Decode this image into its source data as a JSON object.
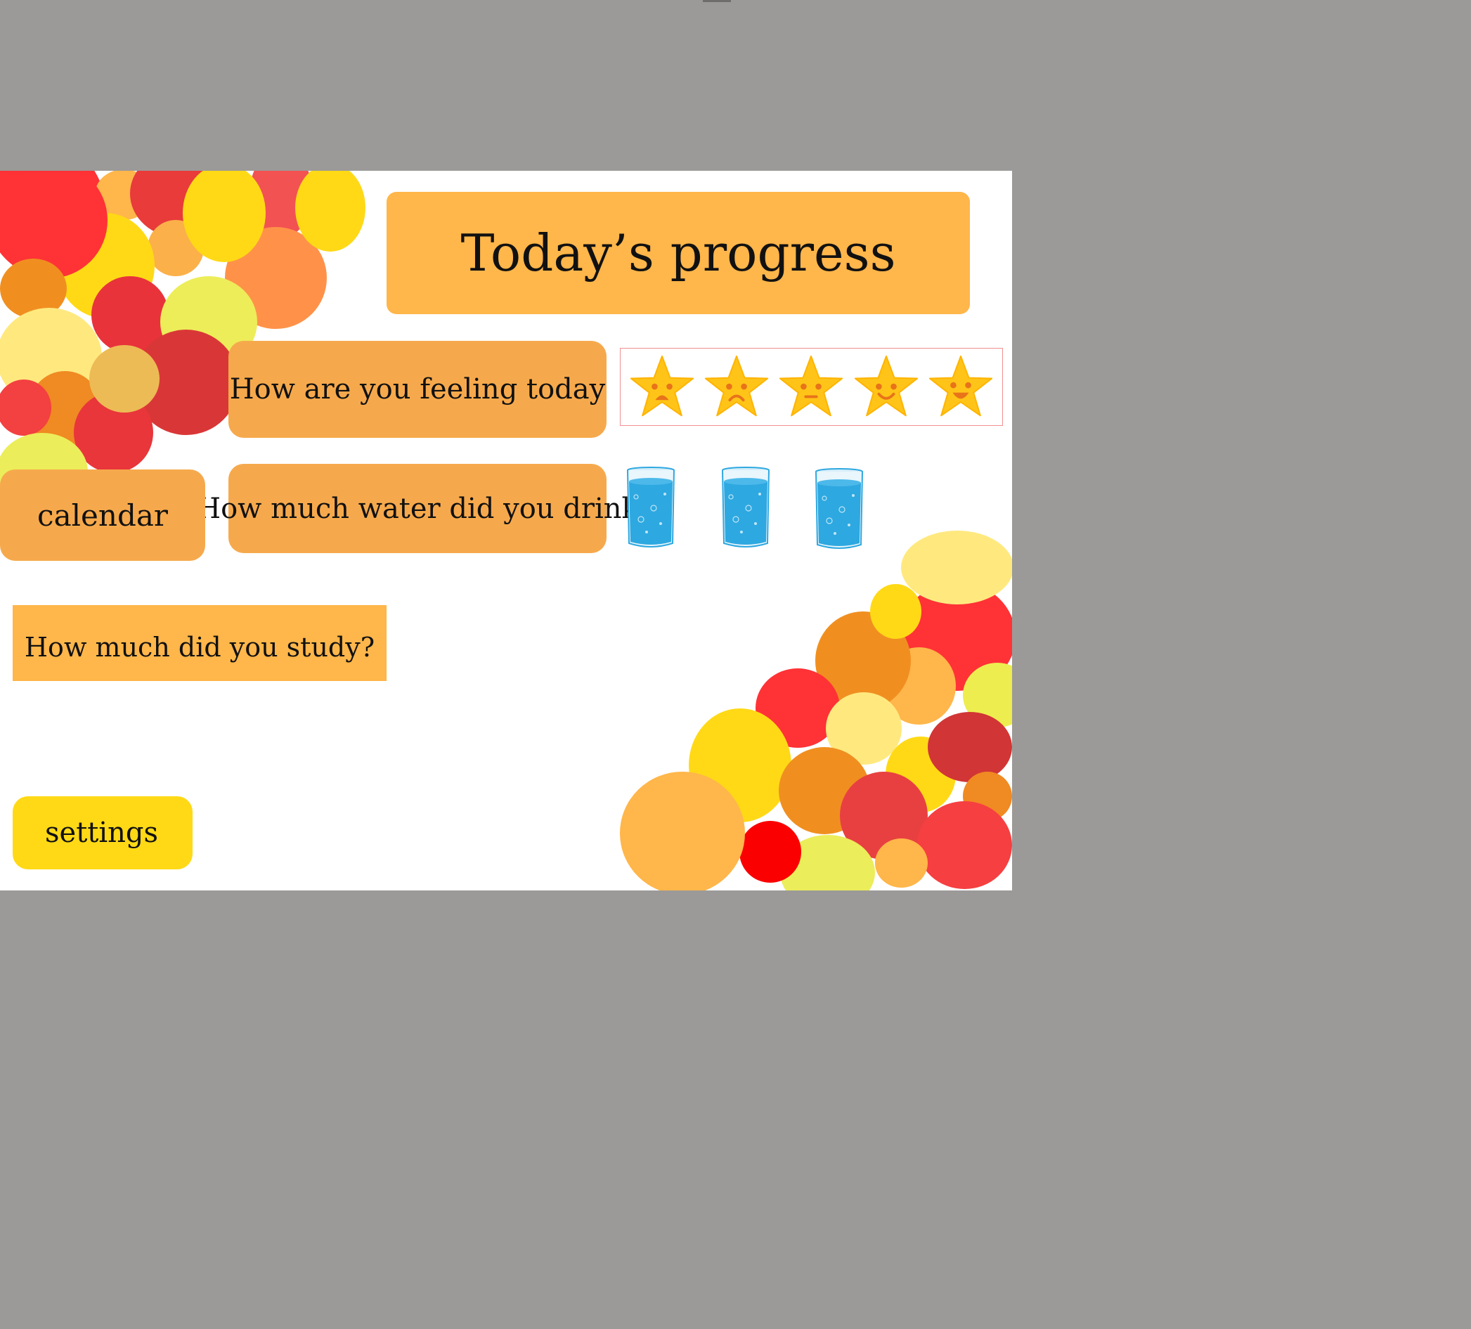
{
  "page": {
    "title": "Today’s progress"
  },
  "questions": {
    "feeling": "How are you feeling today",
    "water": "How much water did you drink",
    "study": "How much did you study?"
  },
  "nav": {
    "calendar_label": "calendar",
    "settings_label": "settings"
  },
  "mood_rating": {
    "options": [
      "very-sad-star-icon",
      "sad-star-icon",
      "neutral-star-icon",
      "smile-star-icon",
      "happy-star-icon"
    ]
  },
  "water_glasses": {
    "count": 3,
    "icon": "water-glass-icon"
  },
  "colors": {
    "background": "#9b9a98",
    "slide": "#ffffff",
    "title_panel": "#ffb64a",
    "question_panel": "#f6a94c",
    "settings_button": "#ffd916",
    "star": "#ffc417",
    "star_face": "#e8731a",
    "water": "#2ea8e0"
  }
}
